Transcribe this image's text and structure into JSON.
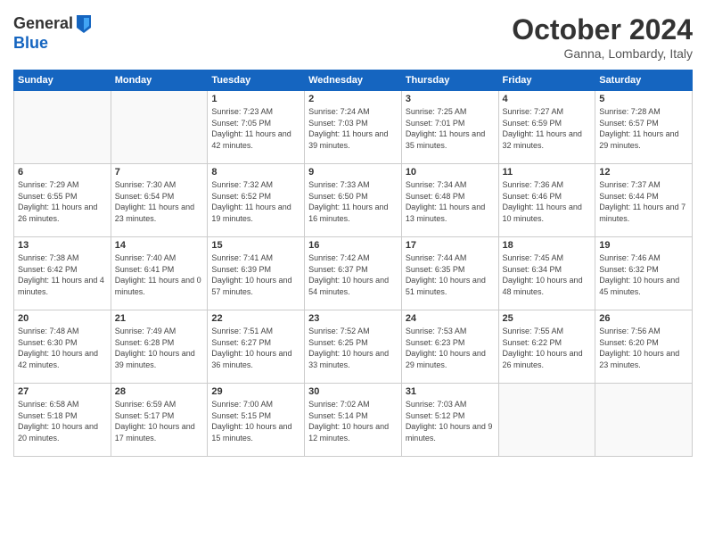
{
  "header": {
    "logo_line1": "General",
    "logo_line2": "Blue",
    "month_title": "October 2024",
    "location": "Ganna, Lombardy, Italy"
  },
  "weekdays": [
    "Sunday",
    "Monday",
    "Tuesday",
    "Wednesday",
    "Thursday",
    "Friday",
    "Saturday"
  ],
  "weeks": [
    [
      {
        "day": "",
        "info": ""
      },
      {
        "day": "",
        "info": ""
      },
      {
        "day": "1",
        "info": "Sunrise: 7:23 AM\nSunset: 7:05 PM\nDaylight: 11 hours and 42 minutes."
      },
      {
        "day": "2",
        "info": "Sunrise: 7:24 AM\nSunset: 7:03 PM\nDaylight: 11 hours and 39 minutes."
      },
      {
        "day": "3",
        "info": "Sunrise: 7:25 AM\nSunset: 7:01 PM\nDaylight: 11 hours and 35 minutes."
      },
      {
        "day": "4",
        "info": "Sunrise: 7:27 AM\nSunset: 6:59 PM\nDaylight: 11 hours and 32 minutes."
      },
      {
        "day": "5",
        "info": "Sunrise: 7:28 AM\nSunset: 6:57 PM\nDaylight: 11 hours and 29 minutes."
      }
    ],
    [
      {
        "day": "6",
        "info": "Sunrise: 7:29 AM\nSunset: 6:55 PM\nDaylight: 11 hours and 26 minutes."
      },
      {
        "day": "7",
        "info": "Sunrise: 7:30 AM\nSunset: 6:54 PM\nDaylight: 11 hours and 23 minutes."
      },
      {
        "day": "8",
        "info": "Sunrise: 7:32 AM\nSunset: 6:52 PM\nDaylight: 11 hours and 19 minutes."
      },
      {
        "day": "9",
        "info": "Sunrise: 7:33 AM\nSunset: 6:50 PM\nDaylight: 11 hours and 16 minutes."
      },
      {
        "day": "10",
        "info": "Sunrise: 7:34 AM\nSunset: 6:48 PM\nDaylight: 11 hours and 13 minutes."
      },
      {
        "day": "11",
        "info": "Sunrise: 7:36 AM\nSunset: 6:46 PM\nDaylight: 11 hours and 10 minutes."
      },
      {
        "day": "12",
        "info": "Sunrise: 7:37 AM\nSunset: 6:44 PM\nDaylight: 11 hours and 7 minutes."
      }
    ],
    [
      {
        "day": "13",
        "info": "Sunrise: 7:38 AM\nSunset: 6:42 PM\nDaylight: 11 hours and 4 minutes."
      },
      {
        "day": "14",
        "info": "Sunrise: 7:40 AM\nSunset: 6:41 PM\nDaylight: 11 hours and 0 minutes."
      },
      {
        "day": "15",
        "info": "Sunrise: 7:41 AM\nSunset: 6:39 PM\nDaylight: 10 hours and 57 minutes."
      },
      {
        "day": "16",
        "info": "Sunrise: 7:42 AM\nSunset: 6:37 PM\nDaylight: 10 hours and 54 minutes."
      },
      {
        "day": "17",
        "info": "Sunrise: 7:44 AM\nSunset: 6:35 PM\nDaylight: 10 hours and 51 minutes."
      },
      {
        "day": "18",
        "info": "Sunrise: 7:45 AM\nSunset: 6:34 PM\nDaylight: 10 hours and 48 minutes."
      },
      {
        "day": "19",
        "info": "Sunrise: 7:46 AM\nSunset: 6:32 PM\nDaylight: 10 hours and 45 minutes."
      }
    ],
    [
      {
        "day": "20",
        "info": "Sunrise: 7:48 AM\nSunset: 6:30 PM\nDaylight: 10 hours and 42 minutes."
      },
      {
        "day": "21",
        "info": "Sunrise: 7:49 AM\nSunset: 6:28 PM\nDaylight: 10 hours and 39 minutes."
      },
      {
        "day": "22",
        "info": "Sunrise: 7:51 AM\nSunset: 6:27 PM\nDaylight: 10 hours and 36 minutes."
      },
      {
        "day": "23",
        "info": "Sunrise: 7:52 AM\nSunset: 6:25 PM\nDaylight: 10 hours and 33 minutes."
      },
      {
        "day": "24",
        "info": "Sunrise: 7:53 AM\nSunset: 6:23 PM\nDaylight: 10 hours and 29 minutes."
      },
      {
        "day": "25",
        "info": "Sunrise: 7:55 AM\nSunset: 6:22 PM\nDaylight: 10 hours and 26 minutes."
      },
      {
        "day": "26",
        "info": "Sunrise: 7:56 AM\nSunset: 6:20 PM\nDaylight: 10 hours and 23 minutes."
      }
    ],
    [
      {
        "day": "27",
        "info": "Sunrise: 6:58 AM\nSunset: 5:18 PM\nDaylight: 10 hours and 20 minutes."
      },
      {
        "day": "28",
        "info": "Sunrise: 6:59 AM\nSunset: 5:17 PM\nDaylight: 10 hours and 17 minutes."
      },
      {
        "day": "29",
        "info": "Sunrise: 7:00 AM\nSunset: 5:15 PM\nDaylight: 10 hours and 15 minutes."
      },
      {
        "day": "30",
        "info": "Sunrise: 7:02 AM\nSunset: 5:14 PM\nDaylight: 10 hours and 12 minutes."
      },
      {
        "day": "31",
        "info": "Sunrise: 7:03 AM\nSunset: 5:12 PM\nDaylight: 10 hours and 9 minutes."
      },
      {
        "day": "",
        "info": ""
      },
      {
        "day": "",
        "info": ""
      }
    ]
  ]
}
